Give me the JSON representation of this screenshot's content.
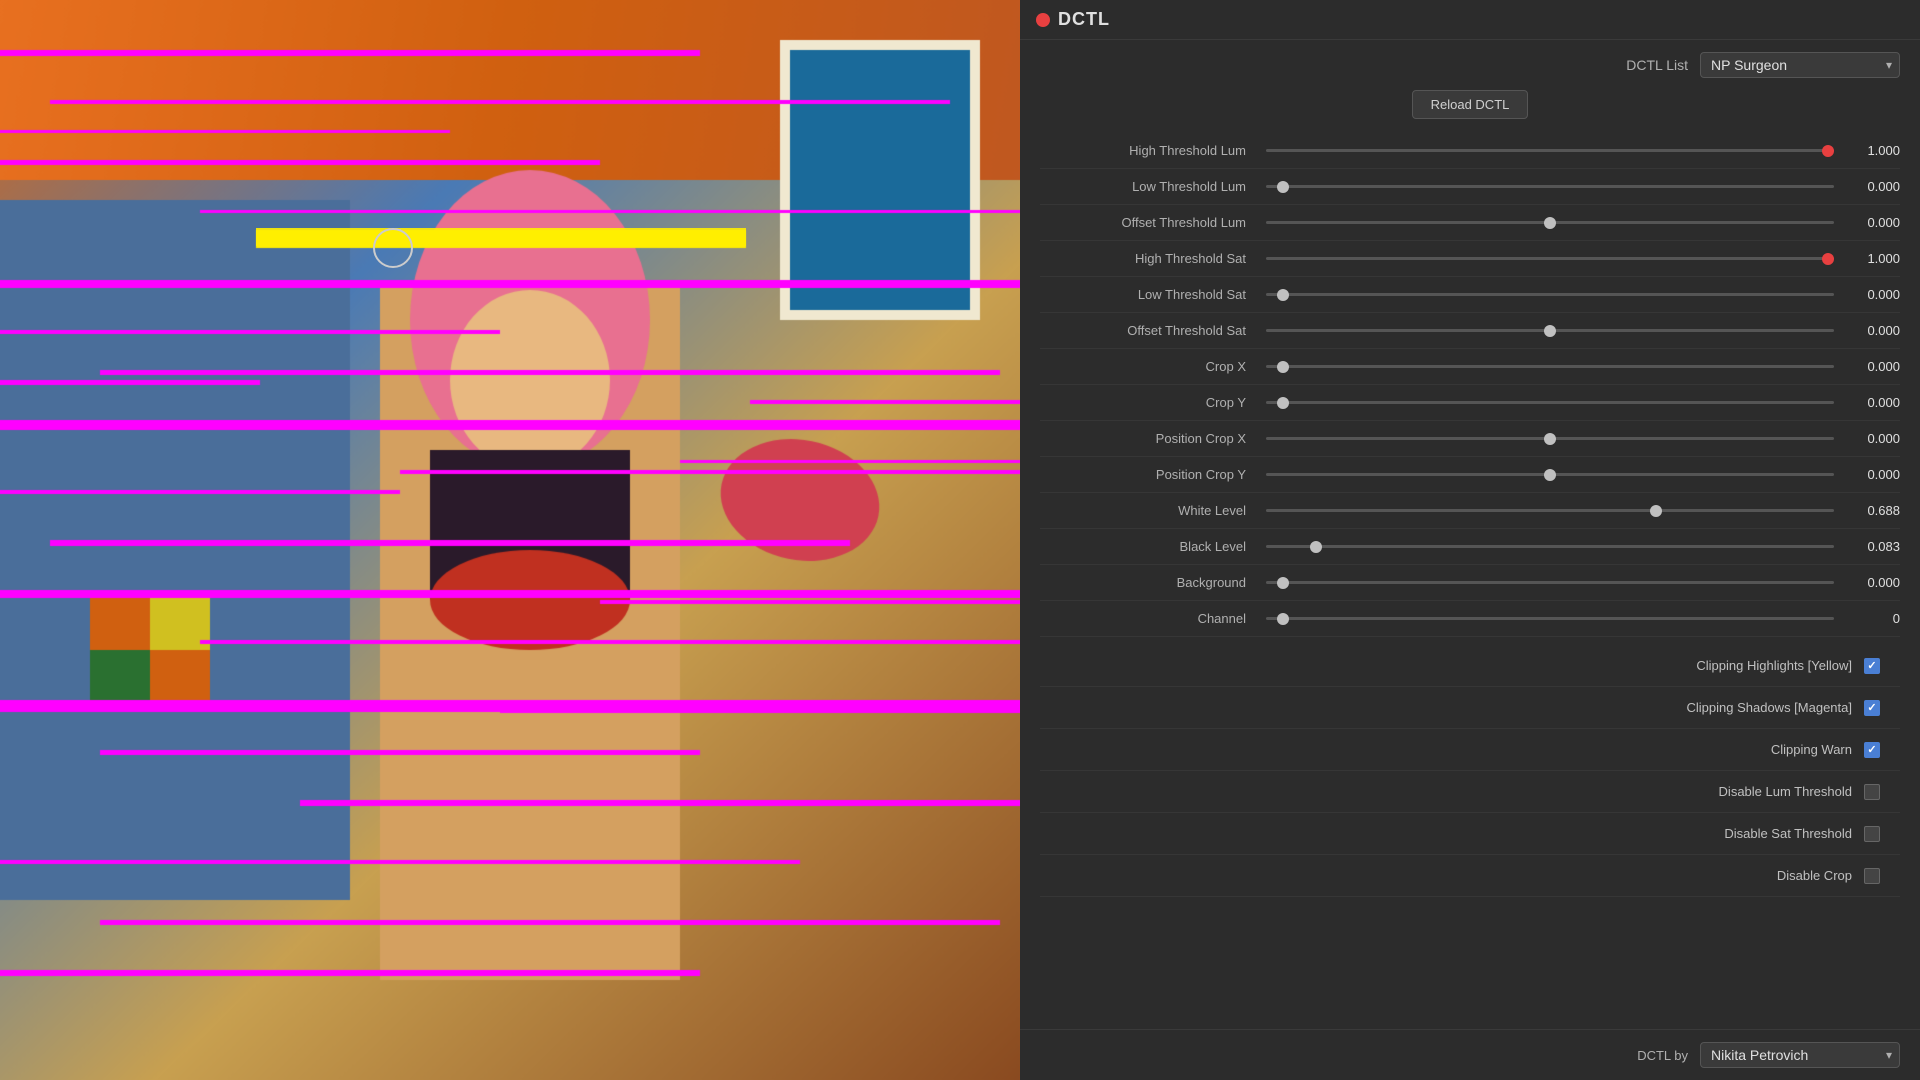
{
  "panel": {
    "title": "DCTL",
    "reload_button": "Reload DCTL",
    "dctl_list_label": "DCTL List",
    "dctl_list_value": "NP Surgeon",
    "dctl_by_label": "DCTL by",
    "dctl_by_value": "Nikita Petrovich"
  },
  "params": [
    {
      "label": "High Threshold Lum",
      "value": "1.000",
      "pct": 100,
      "at_max": true
    },
    {
      "label": "Low Threshold Lum",
      "value": "0.000",
      "pct": 2,
      "at_max": false
    },
    {
      "label": "Offset Threshold Lum",
      "value": "0.000",
      "pct": 50,
      "at_max": false
    },
    {
      "label": "High Threshold Sat",
      "value": "1.000",
      "pct": 100,
      "at_max": true
    },
    {
      "label": "Low Threshold Sat",
      "value": "0.000",
      "pct": 2,
      "at_max": false
    },
    {
      "label": "Offset Threshold Sat",
      "value": "0.000",
      "pct": 50,
      "at_max": false
    },
    {
      "label": "Crop X",
      "value": "0.000",
      "pct": 2,
      "at_max": false
    },
    {
      "label": "Crop Y",
      "value": "0.000",
      "pct": 2,
      "at_max": false
    },
    {
      "label": "Position Crop X",
      "value": "0.000",
      "pct": 50,
      "at_max": false
    },
    {
      "label": "Position Crop Y",
      "value": "0.000",
      "pct": 50,
      "at_max": false
    },
    {
      "label": "White Level",
      "value": "0.688",
      "pct": 69,
      "at_max": false
    },
    {
      "label": "Black Level",
      "value": "0.083",
      "pct": 8,
      "at_max": false
    },
    {
      "label": "Background",
      "value": "0.000",
      "pct": 2,
      "at_max": false
    },
    {
      "label": "Channel",
      "value": "0",
      "pct": 2,
      "at_max": false
    }
  ],
  "checkboxes": [
    {
      "label": "Clipping Highlights [Yellow]",
      "checked": true
    },
    {
      "label": "Clipping Shadows [Magenta]",
      "checked": true
    },
    {
      "label": "Clipping Warn",
      "checked": true
    },
    {
      "label": "Disable Lum Threshold",
      "checked": false
    },
    {
      "label": "Disable Sat Threshold",
      "checked": false
    },
    {
      "label": "Disable Crop",
      "checked": false
    }
  ],
  "icons": {
    "dropdown_arrow": "▾",
    "checkmark": "✓"
  }
}
